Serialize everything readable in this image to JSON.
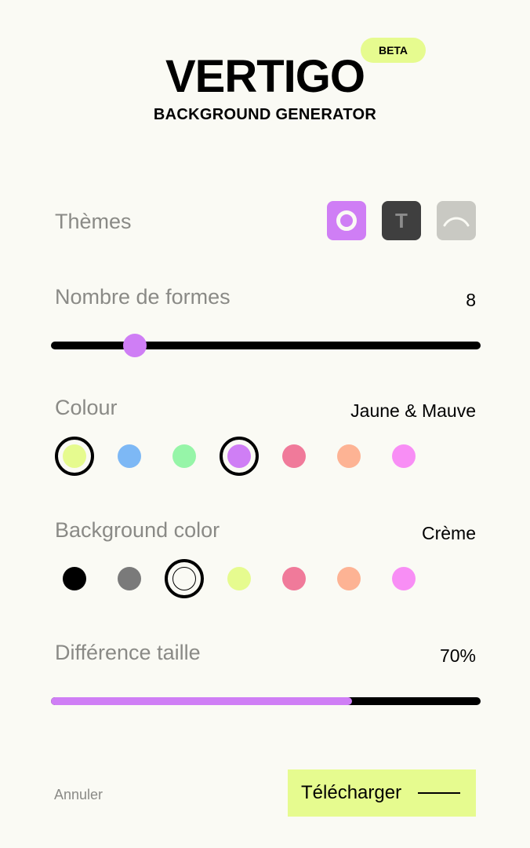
{
  "header": {
    "title": "VERTIGO",
    "subtitle": "BACKGROUND GENERATOR",
    "badge": "BETA"
  },
  "themes": {
    "label": "Thèmes",
    "options": [
      {
        "name": "circle",
        "icon": "circle-ring-icon",
        "color": "#cf7ef5",
        "selected": true
      },
      {
        "name": "text",
        "icon": "letter-t-icon",
        "letter": "T",
        "color": "#3f3f3f",
        "selected": false
      },
      {
        "name": "wave",
        "icon": "wave-icon",
        "color": "#c9c9c3",
        "selected": false
      }
    ]
  },
  "shapes": {
    "label": "Nombre de formes",
    "value": "8",
    "slider_fraction": 0.195
  },
  "colour": {
    "label": "Colour",
    "value": "Jaune & Mauve",
    "swatches": [
      {
        "color": "#e6fb8f",
        "selected": true
      },
      {
        "color": "#7db8f5",
        "selected": false
      },
      {
        "color": "#96f5a8",
        "selected": false
      },
      {
        "color": "#cf7ef5",
        "selected": true
      },
      {
        "color": "#f07a9a",
        "selected": false
      },
      {
        "color": "#fdb394",
        "selected": false
      },
      {
        "color": "#f88ef5",
        "selected": false
      }
    ]
  },
  "background": {
    "label": "Background color",
    "value": "Crème",
    "swatches": [
      {
        "color": "#000000",
        "selected": false
      },
      {
        "color": "#7a7a7a",
        "selected": false
      },
      {
        "color": "#fafaf4",
        "selected": true
      },
      {
        "color": "#e6fb8f",
        "selected": false
      },
      {
        "color": "#f07a9a",
        "selected": false
      },
      {
        "color": "#fdb394",
        "selected": false
      },
      {
        "color": "#f88ef5",
        "selected": false
      }
    ]
  },
  "size_difference": {
    "label": "Différence taille",
    "value": "70%",
    "fraction": 0.7
  },
  "footer": {
    "cancel_label": "Annuler",
    "download_label": "Télécharger"
  },
  "colors": {
    "accent": "#cf7ef5",
    "highlight": "#e6fb8f",
    "background": "#fafaf4",
    "muted_text": "#8a8a86"
  }
}
